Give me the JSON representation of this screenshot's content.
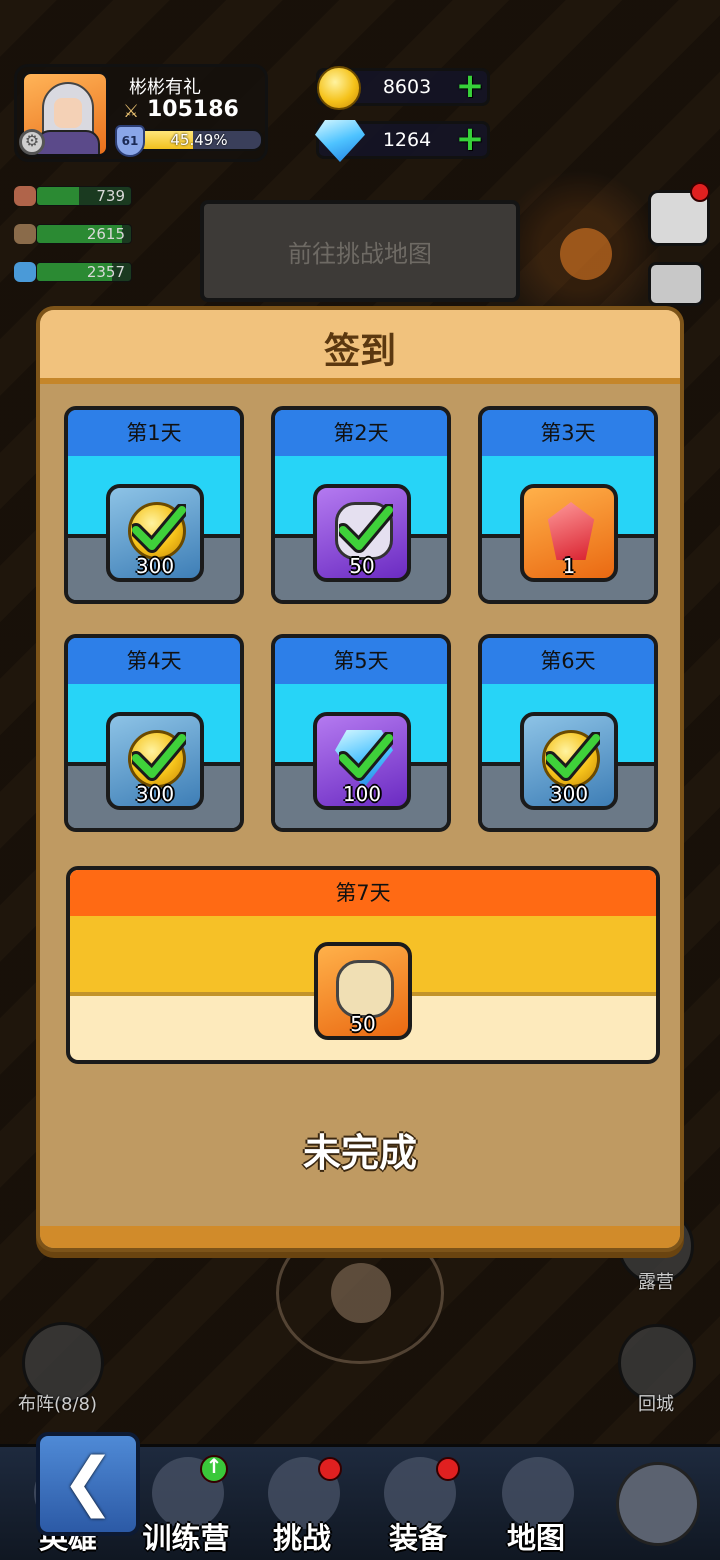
{
  "player": {
    "name": "彬彬有礼",
    "power": "105186",
    "level": "61",
    "exp_percent": "45.49%",
    "exp_fraction": 0.4549
  },
  "currency": {
    "gold": "8603",
    "diamond": "1264"
  },
  "resources": [
    {
      "value": "739",
      "fill": 0.45,
      "icon": "meat-icon",
      "color": "#b0644a"
    },
    {
      "value": "2615",
      "fill": 0.9,
      "icon": "wood-icon",
      "color": "#8a6b4a"
    },
    {
      "value": "2357",
      "fill": 0.8,
      "icon": "crystal-icon",
      "color": "#4a9ad8"
    }
  ],
  "map_button": {
    "label": "前往挑战地图"
  },
  "signin": {
    "title": "签到",
    "days": [
      {
        "label": "第1天",
        "reward_qty": "300",
        "item": "gold-coin-icon",
        "checked": true
      },
      {
        "label": "第2天",
        "reward_qty": "50",
        "item": "scroll-icon",
        "checked": true
      },
      {
        "label": "第3天",
        "reward_qty": "1",
        "item": "red-crystal-icon",
        "checked": false
      },
      {
        "label": "第4天",
        "reward_qty": "300",
        "item": "gold-coin-icon",
        "checked": true
      },
      {
        "label": "第5天",
        "reward_qty": "100",
        "item": "diamond-icon",
        "checked": true
      },
      {
        "label": "第6天",
        "reward_qty": "300",
        "item": "gold-coin-icon",
        "checked": true
      }
    ],
    "day7": {
      "label": "第7天",
      "reward_qty": "50",
      "item": "hero-portrait-icon"
    },
    "status": "未完成"
  },
  "side": {
    "camp_label": "露营",
    "return_label": "回城",
    "formation_label": "布阵(8/8)"
  },
  "nav": {
    "hero": "英雄",
    "training": "训练营",
    "challenge": "挑战",
    "equipment": "装备",
    "map": "地图"
  },
  "colors": {
    "day_header": "#2d7fe8",
    "day_mid": "#27d4f7",
    "day7_header": "#ff6a14",
    "panel_bg": "#bf9a62",
    "check_green": "#3fd13a"
  }
}
